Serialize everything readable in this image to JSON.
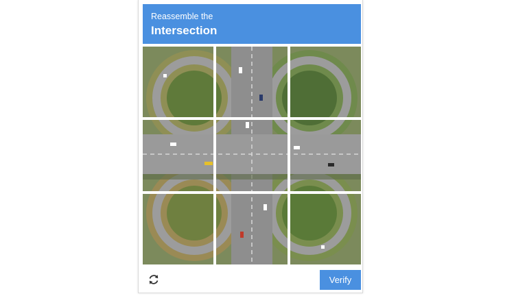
{
  "captcha": {
    "prompt": "Reassemble the",
    "target": "Intersection",
    "verify_label": "Verify",
    "accent_color": "#4a90e0",
    "reload_icon": "refresh-icon",
    "tiles": [
      {
        "name": "puzzle-tile-1"
      },
      {
        "name": "puzzle-tile-2"
      },
      {
        "name": "puzzle-tile-3"
      },
      {
        "name": "puzzle-tile-4"
      },
      {
        "name": "puzzle-tile-5"
      },
      {
        "name": "puzzle-tile-6"
      },
      {
        "name": "puzzle-tile-7"
      },
      {
        "name": "puzzle-tile-8"
      },
      {
        "name": "puzzle-tile-9"
      }
    ]
  }
}
